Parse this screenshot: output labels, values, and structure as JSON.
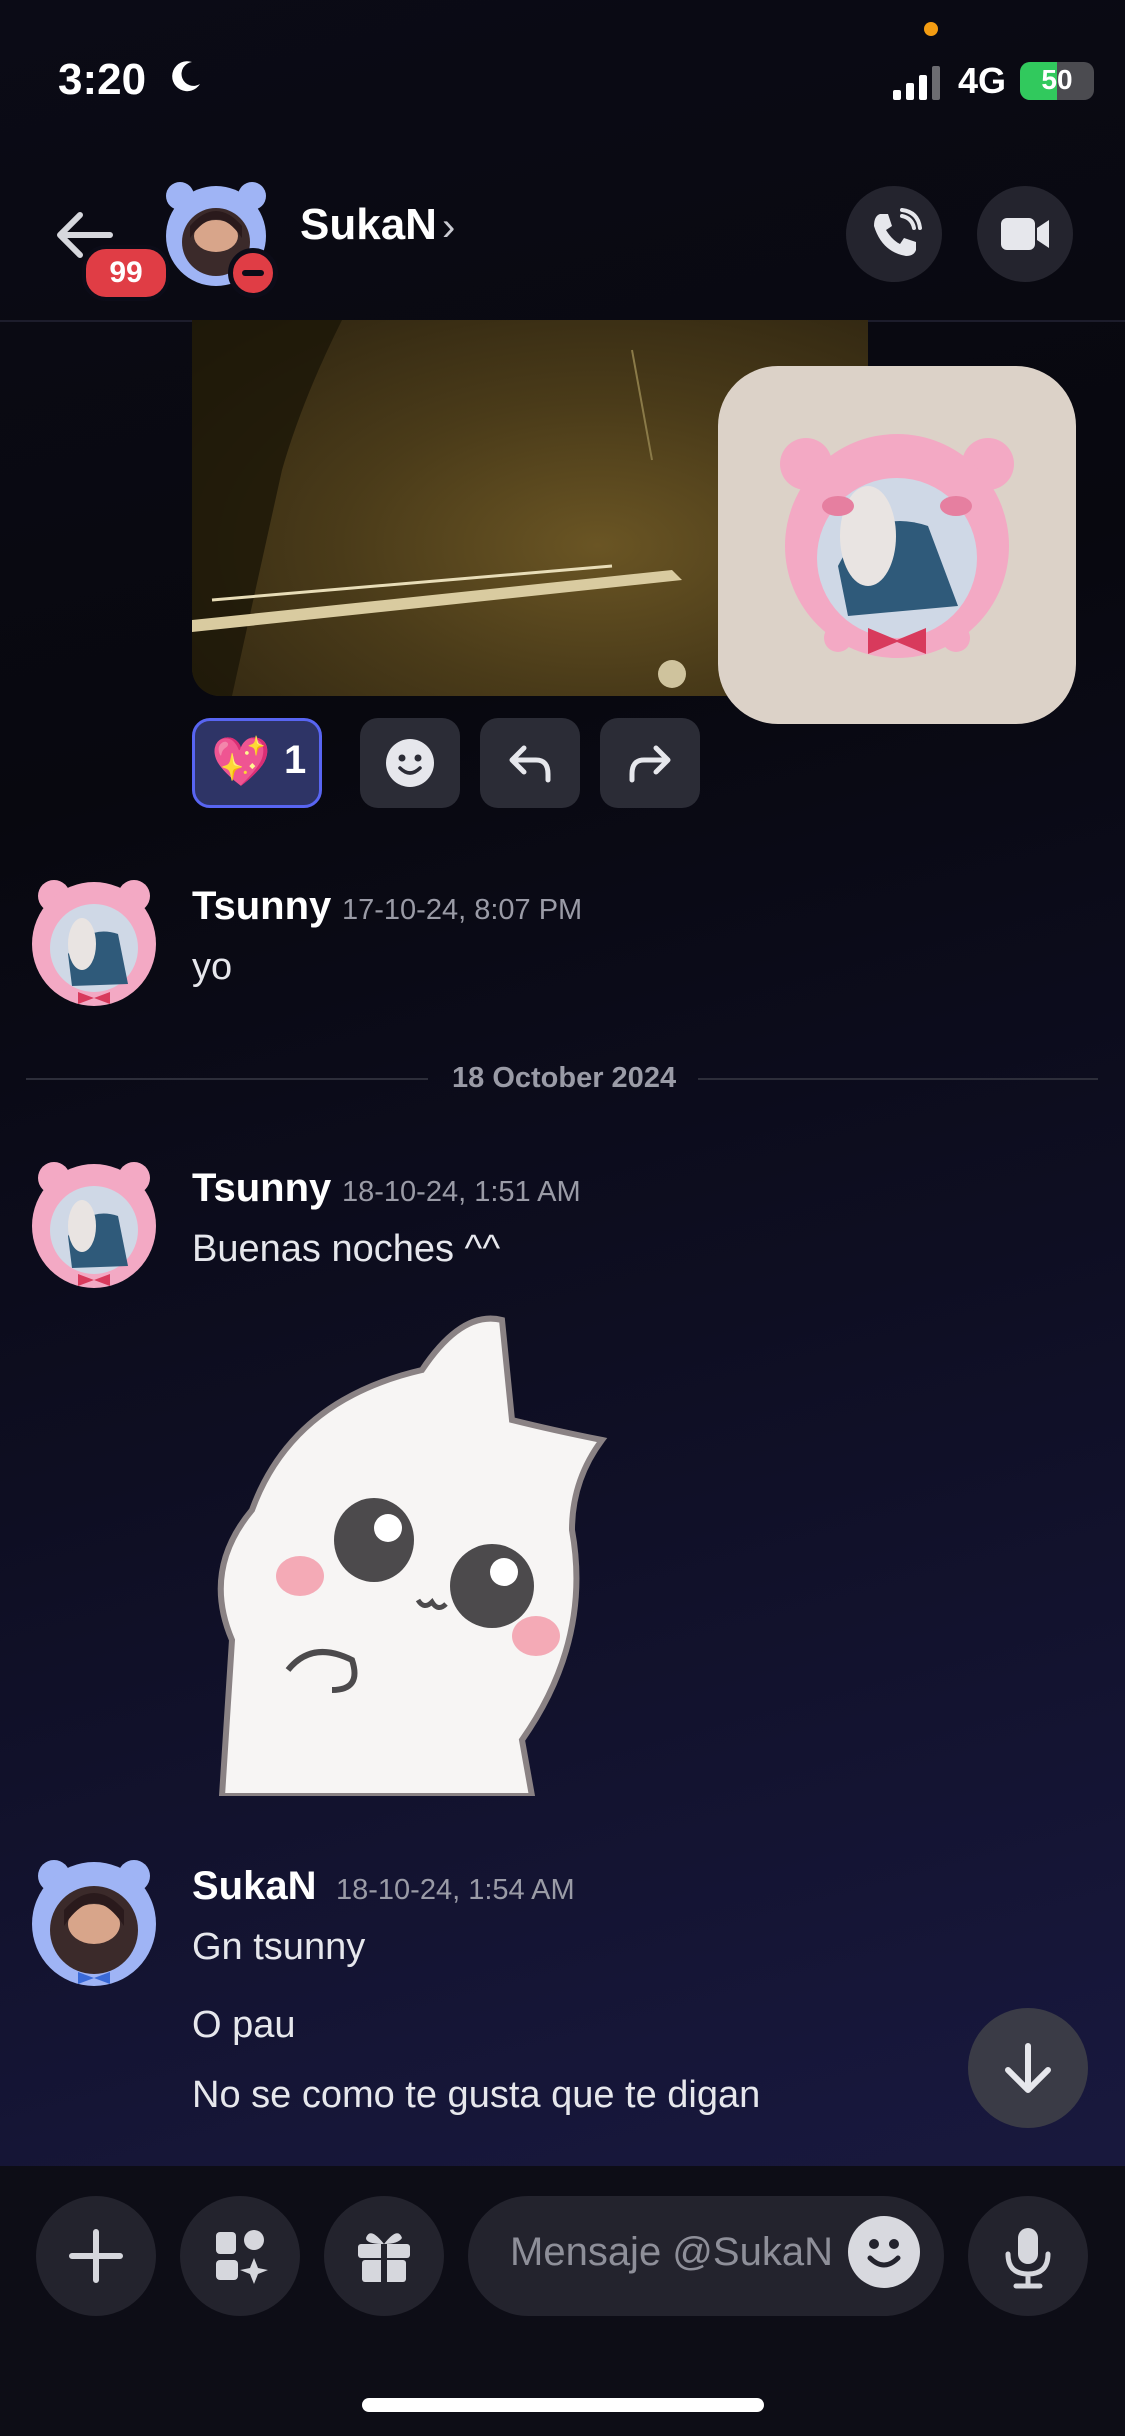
{
  "status": {
    "time": "3:20",
    "network": "4G",
    "battery": "50",
    "battery_level": 0.5
  },
  "header": {
    "back_badge": "99",
    "name": "SukaN"
  },
  "reaction": {
    "emoji": "💖",
    "count": "1"
  },
  "messages": [
    {
      "author": "Tsunny",
      "timestamp": "17-10-24, 8:07 PM",
      "lines": [
        "yo"
      ]
    },
    {
      "author": "Tsunny",
      "timestamp": "18-10-24, 1:51 AM",
      "lines": [
        "Buenas noches ^^"
      ]
    },
    {
      "author": "SukaN",
      "timestamp": "18-10-24, 1:54 AM",
      "lines": [
        "Gn tsunny",
        "O pau",
        "No se como te gusta que te digan"
      ]
    }
  ],
  "date_divider": "18 October 2024",
  "composer": {
    "placeholder": "Mensaje @SukaN"
  },
  "colors": {
    "accent": "#5865f2",
    "badge": "#e03d45",
    "battery": "#31c95d",
    "pink_frame": "#f3a9c4",
    "blue_frame": "#9fb4f5"
  },
  "icons": [
    "moon-icon",
    "signal-icon",
    "back-arrow-icon",
    "chevron-right-icon",
    "phone-icon",
    "video-icon",
    "smile-icon",
    "reply-icon",
    "forward-icon",
    "arrow-down-icon",
    "plus-icon",
    "apps-icon",
    "gift-icon",
    "microphone-icon"
  ]
}
